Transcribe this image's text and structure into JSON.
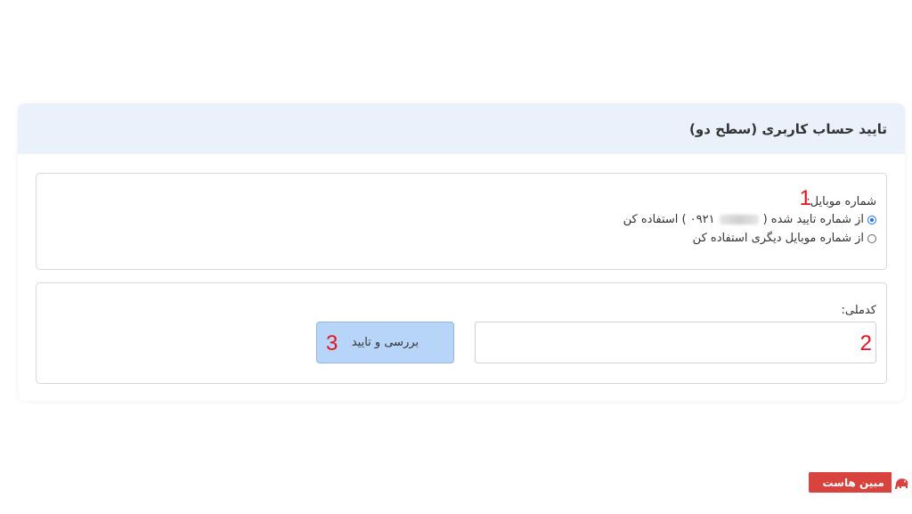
{
  "card": {
    "title": "تایید حساب کاربری (سطح دو)"
  },
  "mobile": {
    "label": "شماره موبایل:",
    "options": [
      {
        "prefix": "از شماره تایید شده (",
        "number_visible": "۰۹۲۱",
        "suffix": ") استفاده کن",
        "selected": true
      },
      {
        "text": "از شماره موبایل دیگری استفاده کن",
        "selected": false
      }
    ]
  },
  "national_code": {
    "label": "کدملی:",
    "value": ""
  },
  "submit": {
    "label": "بررسی و تایید"
  },
  "annotations": {
    "one": "1",
    "two": "2",
    "three": "3"
  },
  "brand": {
    "name": "مبین هاست",
    "color": "#d8433e"
  },
  "colors": {
    "header_bg": "#eaf1fb",
    "button_bg": "#b7d5f9",
    "annotation": "#e8101a",
    "radio_accent": "#1a73e8"
  }
}
